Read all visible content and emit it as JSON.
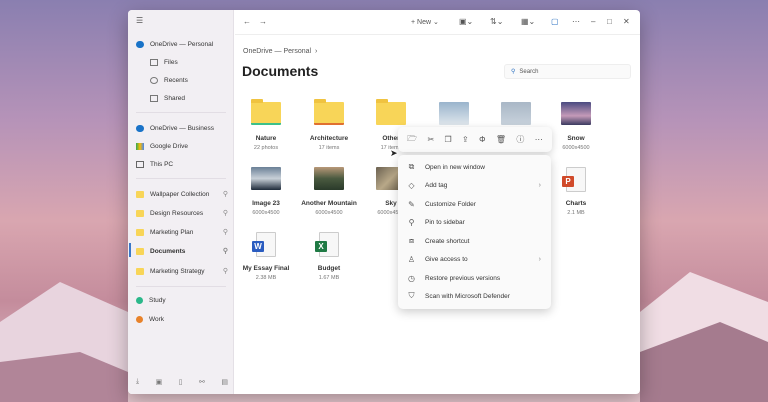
{
  "sidebar": {
    "cloud": [
      {
        "label": "OneDrive — Personal",
        "icon": "cloud-icon"
      }
    ],
    "sub": [
      {
        "label": "Files"
      },
      {
        "label": "Recents"
      },
      {
        "label": "Shared"
      }
    ],
    "drives": [
      {
        "label": "OneDrive — Business"
      },
      {
        "label": "Google Drive"
      },
      {
        "label": "This PC"
      }
    ],
    "pinned": [
      {
        "label": "Wallpaper Collection"
      },
      {
        "label": "Design Resources"
      },
      {
        "label": "Marketing Plan"
      },
      {
        "label": "Documents"
      },
      {
        "label": "Marketing Strategy"
      }
    ],
    "tags": [
      {
        "label": "Study",
        "color": "#2bb88a"
      },
      {
        "label": "Work",
        "color": "#e8822a"
      }
    ]
  },
  "toolbar": {
    "new_label": "New"
  },
  "breadcrumb": "OneDrive — Personal",
  "title": "Documents",
  "search": {
    "placeholder": "Search"
  },
  "items": [
    {
      "name": "Nature",
      "sub": "22 photos"
    },
    {
      "name": "Architecture",
      "sub": "17 items"
    },
    {
      "name": "Other",
      "sub": "17 items"
    },
    {
      "name": "Snow",
      "sub": "6000x4500"
    },
    {
      "name": "Image 23",
      "sub": "6000x4500"
    },
    {
      "name": "Another Mountain",
      "sub": "6000x4500"
    },
    {
      "name": "Sky",
      "sub": "6000x4500"
    },
    {
      "name": "Charts",
      "sub": "2.1 MB"
    },
    {
      "name": "My Essay Final",
      "sub": "2.38 MB"
    },
    {
      "name": "Budget",
      "sub": "1.67 MB"
    }
  ],
  "menu": [
    "Open in new window",
    "Add tag",
    "Customize Folder",
    "Pin to sidebar",
    "Create shortcut",
    "Give access to",
    "Restore previous versions",
    "Scan with Microsoft Defender"
  ]
}
